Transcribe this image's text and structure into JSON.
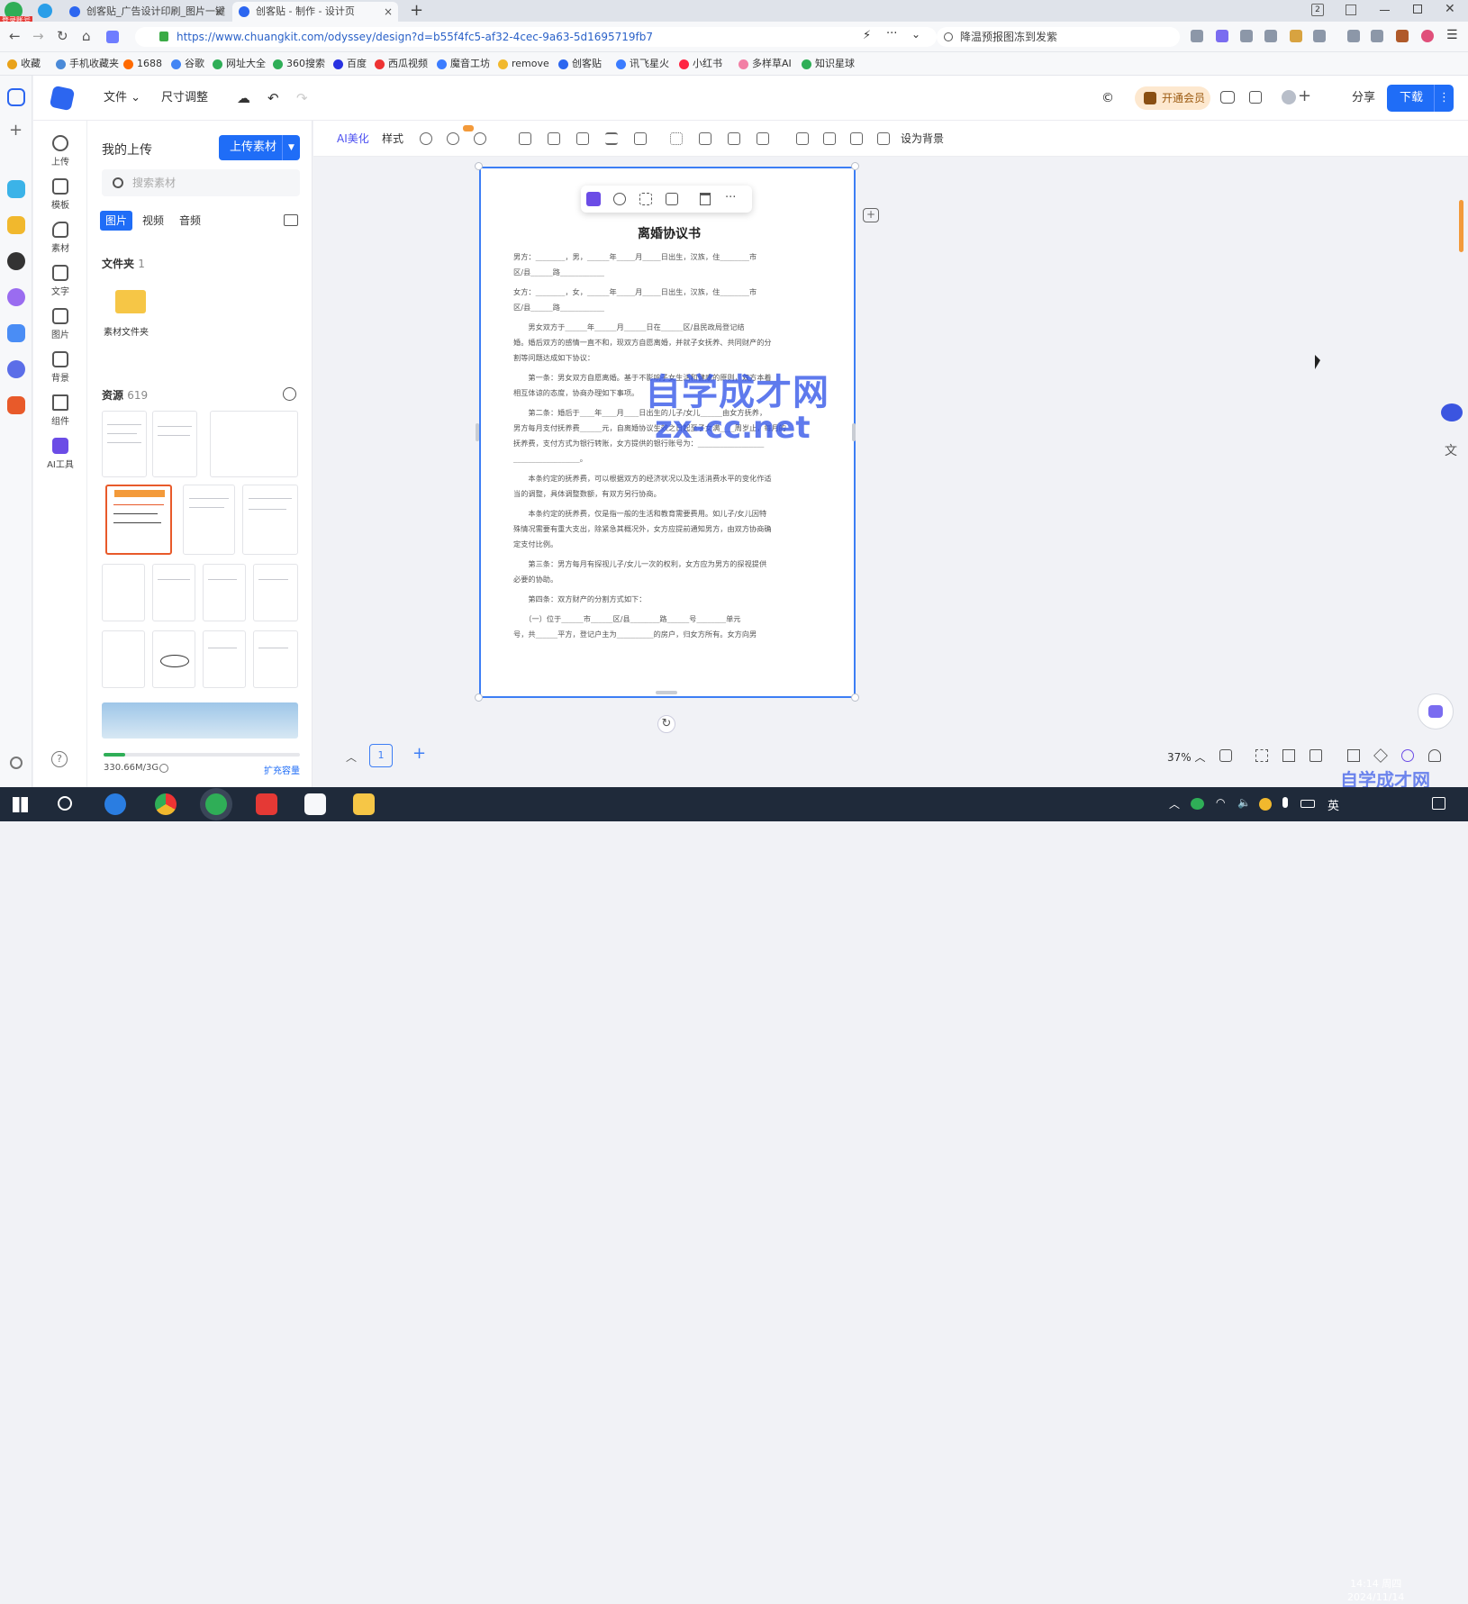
{
  "browser": {
    "badge": "登录账号",
    "tabs": [
      {
        "label": "创客贴_广告设计印刷_图片一键",
        "active": false
      },
      {
        "label": "创客贴 - 制作 - 设计页",
        "active": true
      }
    ],
    "new_tab": "+",
    "url": "https://www.chuangkit.com/odyssey/design?d=b55f4fc5-af32-4cec-9a63-5d1695719fb7",
    "search_text": "降温预报图冻到发紫",
    "tab_count": "2",
    "bookmarks": [
      {
        "label": "收藏",
        "color": "#e9a21a"
      },
      {
        "label": "手机收藏夹",
        "color": "#4a8ad8"
      },
      {
        "label": "1688",
        "color": "#ff6a00"
      },
      {
        "label": "谷歌",
        "color": "#4285f4"
      },
      {
        "label": "网址大全",
        "color": "#2fae57"
      },
      {
        "label": "360搜索",
        "color": "#2fae57"
      },
      {
        "label": "百度",
        "color": "#2932e1"
      },
      {
        "label": "西瓜视频",
        "color": "#e33"
      },
      {
        "label": "魔音工坊",
        "color": "#3b7cff"
      },
      {
        "label": "remove",
        "color": "#f1b82d"
      },
      {
        "label": "创客贴",
        "color": "#2c66f0"
      },
      {
        "label": "讯飞星火",
        "color": "#3b7cff"
      },
      {
        "label": "小红书",
        "color": "#ff2442"
      },
      {
        "label": "多样草AI",
        "color": "#f27fa5"
      },
      {
        "label": "知识星球",
        "color": "#2fae57"
      }
    ]
  },
  "app": {
    "menu_file": "文件",
    "menu_resize": "尺寸调整",
    "vip_label": "开通会员",
    "share_label": "分享",
    "download_label": "下载",
    "download_more": "⋮"
  },
  "tool_rail": [
    {
      "label": "上传"
    },
    {
      "label": "模板"
    },
    {
      "label": "素材"
    },
    {
      "label": "文字"
    },
    {
      "label": "图片"
    },
    {
      "label": "背景"
    },
    {
      "label": "组件"
    },
    {
      "label": "AI工具"
    }
  ],
  "panel": {
    "title": "我的上传",
    "upload_button": "上传素材",
    "search_placeholder": "搜索素材",
    "media_tabs": [
      "图片",
      "视频",
      "音频"
    ],
    "folders_label": "文件夹",
    "folders_count": "1",
    "folder_name": "素材文件夹",
    "resources_label": "资源",
    "resources_count": "619",
    "storage_text": "330.66M/3G",
    "storage_fraction": 0.11,
    "expand_label": "扩充容量"
  },
  "context_toolbar": {
    "ai_beautify": "AI美化",
    "style": "样式",
    "set_background": "设为背景"
  },
  "document": {
    "title": "离婚协议书",
    "paragraphs": [
      "男方：________，男，______年_____月_____日出生，汉族，住________市",
      "区/县______路____________",
      "女方：________，女，______年_____月_____日出生，汉族，住________市",
      "区/县______路____________",
      "　　男女双方于______年______月______日在______区/县民政局登记结",
      "婚。婚后双方的感情一直不和，现双方自愿离婚，并就子女抚养、共同财产的分",
      "割等问题达成如下协议：",
      "　　第一条：男女双方自愿离婚。基于不影响子女生活和健康的原则，双方本着",
      "相互体谅的态度，协商办理如下事项。",
      "　　第二条：婚后于____年____月____日出生的儿子/女儿______由女方抚养，",
      "男方每月支付抚养费______元，自离婚协议生效之日起至子女满____周岁止，每月的",
      "抚养费，支付方式为银行转账，女方提供的银行账号为：__________________",
      "__________________。",
      "　　本条约定的抚养费，可以根据双方的经济状况以及生活消费水平的变化作适",
      "当的调整，具体调整数额，有双方另行协商。",
      "　　本条约定的抚养费，仅是指一般的生活和教育需要费用。如儿子/女儿因特",
      "殊情况需要有重大支出，除紧急其概况外，女方应提前通知男方，由双方协商确",
      "定支付比例。",
      "　　第三条：男方每月有探视儿子/女儿一次的权利，女方应为男方的探视提供",
      "必要的协助。",
      "　　第四条：双方财产的分割方式如下：",
      "　　（一）位于______市______区/县________路______号________单元",
      "号，共______平方，登记户主为__________的房户，归女方所有。女方向男"
    ]
  },
  "watermark": {
    "line1": "自学成才网",
    "line2": "zx-cc.net",
    "corner": "自学成才网"
  },
  "bottom": {
    "page_number": "1",
    "add_page": "+",
    "zoom": "37%"
  },
  "taskbar": {
    "ime": "英",
    "time": "14:14",
    "weekday": "周四",
    "date": "2024/11/14"
  }
}
